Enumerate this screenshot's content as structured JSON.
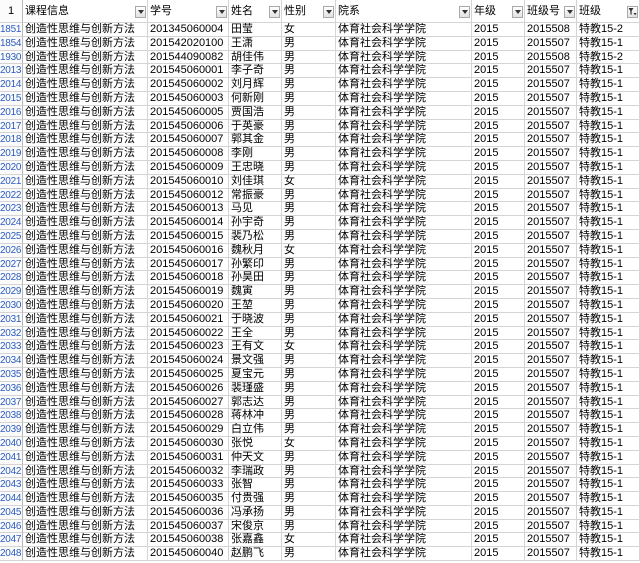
{
  "sheet": {
    "header_row_number": "1",
    "row_number_color": "#2b5bbf",
    "gridline_color": "#d4d4d4",
    "columns": [
      {
        "label": "课程信息",
        "filter_icon": "dropdown-arrow-icon"
      },
      {
        "label": "学号",
        "filter_icon": "dropdown-arrow-icon"
      },
      {
        "label": "姓名",
        "filter_icon": "dropdown-arrow-icon"
      },
      {
        "label": "性别",
        "filter_icon": "dropdown-arrow-icon"
      },
      {
        "label": "院系",
        "filter_icon": "dropdown-arrow-icon"
      },
      {
        "label": "年级",
        "filter_icon": "dropdown-arrow-icon"
      },
      {
        "label": "班级号",
        "filter_icon": "dropdown-arrow-icon"
      },
      {
        "label": "班级",
        "filter_icon": "filter-funnel-icon"
      }
    ],
    "rows": [
      {
        "n": "1851",
        "cells": [
          "创造性思维与创新方法",
          "201345060004",
          "田莹",
          "女",
          "体育社会科学学院",
          "2015",
          "2015508",
          "特教15-2"
        ]
      },
      {
        "n": "1854",
        "cells": [
          "创造性思维与创新方法",
          "201542020100",
          "王潇",
          "男",
          "体育社会科学学院",
          "2015",
          "2015507",
          "特教15-1"
        ]
      },
      {
        "n": "1930",
        "cells": [
          "创造性思维与创新方法",
          "201544090082",
          "胡佳伟",
          "男",
          "体育社会科学学院",
          "2015",
          "2015508",
          "特教15-2"
        ]
      },
      {
        "n": "2013",
        "cells": [
          "创造性思维与创新方法",
          "201545060001",
          "李子奇",
          "男",
          "体育社会科学学院",
          "2015",
          "2015507",
          "特教15-1"
        ]
      },
      {
        "n": "2014",
        "cells": [
          "创造性思维与创新方法",
          "201545060002",
          "刘月辉",
          "男",
          "体育社会科学学院",
          "2015",
          "2015507",
          "特教15-1"
        ]
      },
      {
        "n": "2015",
        "cells": [
          "创造性思维与创新方法",
          "201545060003",
          "何新刚",
          "男",
          "体育社会科学学院",
          "2015",
          "2015507",
          "特教15-1"
        ]
      },
      {
        "n": "2016",
        "cells": [
          "创造性思维与创新方法",
          "201545060005",
          "贾国浩",
          "男",
          "体育社会科学学院",
          "2015",
          "2015507",
          "特教15-1"
        ]
      },
      {
        "n": "2017",
        "cells": [
          "创造性思维与创新方法",
          "201545060006",
          "于英豪",
          "男",
          "体育社会科学学院",
          "2015",
          "2015507",
          "特教15-1"
        ]
      },
      {
        "n": "2018",
        "cells": [
          "创造性思维与创新方法",
          "201545060007",
          "郭其金",
          "男",
          "体育社会科学学院",
          "2015",
          "2015507",
          "特教15-1"
        ]
      },
      {
        "n": "2019",
        "cells": [
          "创造性思维与创新方法",
          "201545060008",
          "李刚",
          "男",
          "体育社会科学学院",
          "2015",
          "2015507",
          "特教15-1"
        ]
      },
      {
        "n": "2020",
        "cells": [
          "创造性思维与创新方法",
          "201545060009",
          "王忠晓",
          "男",
          "体育社会科学学院",
          "2015",
          "2015507",
          "特教15-1"
        ]
      },
      {
        "n": "2021",
        "cells": [
          "创造性思维与创新方法",
          "201545060010",
          "刘佳琪",
          "女",
          "体育社会科学学院",
          "2015",
          "2015507",
          "特教15-1"
        ]
      },
      {
        "n": "2022",
        "cells": [
          "创造性思维与创新方法",
          "201545060012",
          "常振豪",
          "男",
          "体育社会科学学院",
          "2015",
          "2015507",
          "特教15-1"
        ]
      },
      {
        "n": "2023",
        "cells": [
          "创造性思维与创新方法",
          "201545060013",
          "马见",
          "男",
          "体育社会科学学院",
          "2015",
          "2015507",
          "特教15-1"
        ]
      },
      {
        "n": "2024",
        "cells": [
          "创造性思维与创新方法",
          "201545060014",
          "孙宇奇",
          "男",
          "体育社会科学学院",
          "2015",
          "2015507",
          "特教15-1"
        ]
      },
      {
        "n": "2025",
        "cells": [
          "创造性思维与创新方法",
          "201545060015",
          "裴乃松",
          "男",
          "体育社会科学学院",
          "2015",
          "2015507",
          "特教15-1"
        ]
      },
      {
        "n": "2026",
        "cells": [
          "创造性思维与创新方法",
          "201545060016",
          "魏秋月",
          "女",
          "体育社会科学学院",
          "2015",
          "2015507",
          "特教15-1"
        ]
      },
      {
        "n": "2027",
        "cells": [
          "创造性思维与创新方法",
          "201545060017",
          "孙繁印",
          "男",
          "体育社会科学学院",
          "2015",
          "2015507",
          "特教15-1"
        ]
      },
      {
        "n": "2028",
        "cells": [
          "创造性思维与创新方法",
          "201545060018",
          "孙昊田",
          "男",
          "体育社会科学学院",
          "2015",
          "2015507",
          "特教15-1"
        ]
      },
      {
        "n": "2029",
        "cells": [
          "创造性思维与创新方法",
          "201545060019",
          "魏寅",
          "男",
          "体育社会科学学院",
          "2015",
          "2015507",
          "特教15-1"
        ]
      },
      {
        "n": "2030",
        "cells": [
          "创造性思维与创新方法",
          "201545060020",
          "王堃",
          "男",
          "体育社会科学学院",
          "2015",
          "2015507",
          "特教15-1"
        ]
      },
      {
        "n": "2031",
        "cells": [
          "创造性思维与创新方法",
          "201545060021",
          "于晓波",
          "男",
          "体育社会科学学院",
          "2015",
          "2015507",
          "特教15-1"
        ]
      },
      {
        "n": "2032",
        "cells": [
          "创造性思维与创新方法",
          "201545060022",
          "王全",
          "男",
          "体育社会科学学院",
          "2015",
          "2015507",
          "特教15-1"
        ]
      },
      {
        "n": "2033",
        "cells": [
          "创造性思维与创新方法",
          "201545060023",
          "王有文",
          "女",
          "体育社会科学学院",
          "2015",
          "2015507",
          "特教15-1"
        ]
      },
      {
        "n": "2034",
        "cells": [
          "创造性思维与创新方法",
          "201545060024",
          "景文强",
          "男",
          "体育社会科学学院",
          "2015",
          "2015507",
          "特教15-1"
        ]
      },
      {
        "n": "2035",
        "cells": [
          "创造性思维与创新方法",
          "201545060025",
          "夏宝元",
          "男",
          "体育社会科学学院",
          "2015",
          "2015507",
          "特教15-1"
        ]
      },
      {
        "n": "2036",
        "cells": [
          "创造性思维与创新方法",
          "201545060026",
          "裴瑾盛",
          "男",
          "体育社会科学学院",
          "2015",
          "2015507",
          "特教15-1"
        ]
      },
      {
        "n": "2037",
        "cells": [
          "创造性思维与创新方法",
          "201545060027",
          "郭志达",
          "男",
          "体育社会科学学院",
          "2015",
          "2015507",
          "特教15-1"
        ]
      },
      {
        "n": "2038",
        "cells": [
          "创造性思维与创新方法",
          "201545060028",
          "蒋林冲",
          "男",
          "体育社会科学学院",
          "2015",
          "2015507",
          "特教15-1"
        ]
      },
      {
        "n": "2039",
        "cells": [
          "创造性思维与创新方法",
          "201545060029",
          "白立伟",
          "男",
          "体育社会科学学院",
          "2015",
          "2015507",
          "特教15-1"
        ]
      },
      {
        "n": "2040",
        "cells": [
          "创造性思维与创新方法",
          "201545060030",
          "张悦",
          "女",
          "体育社会科学学院",
          "2015",
          "2015507",
          "特教15-1"
        ]
      },
      {
        "n": "2041",
        "cells": [
          "创造性思维与创新方法",
          "201545060031",
          "仲天文",
          "男",
          "体育社会科学学院",
          "2015",
          "2015507",
          "特教15-1"
        ]
      },
      {
        "n": "2042",
        "cells": [
          "创造性思维与创新方法",
          "201545060032",
          "李瑞政",
          "男",
          "体育社会科学学院",
          "2015",
          "2015507",
          "特教15-1"
        ]
      },
      {
        "n": "2043",
        "cells": [
          "创造性思维与创新方法",
          "201545060033",
          "张智",
          "男",
          "体育社会科学学院",
          "2015",
          "2015507",
          "特教15-1"
        ]
      },
      {
        "n": "2044",
        "cells": [
          "创造性思维与创新方法",
          "201545060035",
          "付贵强",
          "男",
          "体育社会科学学院",
          "2015",
          "2015507",
          "特教15-1"
        ]
      },
      {
        "n": "2045",
        "cells": [
          "创造性思维与创新方法",
          "201545060036",
          "冯承扬",
          "男",
          "体育社会科学学院",
          "2015",
          "2015507",
          "特教15-1"
        ]
      },
      {
        "n": "2046",
        "cells": [
          "创造性思维与创新方法",
          "201545060037",
          "宋俊京",
          "男",
          "体育社会科学学院",
          "2015",
          "2015507",
          "特教15-1"
        ]
      },
      {
        "n": "2047",
        "cells": [
          "创造性思维与创新方法",
          "201545060038",
          "张嘉鑫",
          "女",
          "体育社会科学学院",
          "2015",
          "2015507",
          "特教15-1"
        ]
      },
      {
        "n": "2048",
        "cells": [
          "创造性思维与创新方法",
          "201545060040",
          "赵鹏飞",
          "男",
          "体育社会科学学院",
          "2015",
          "2015507",
          "特教15-1"
        ]
      }
    ]
  }
}
